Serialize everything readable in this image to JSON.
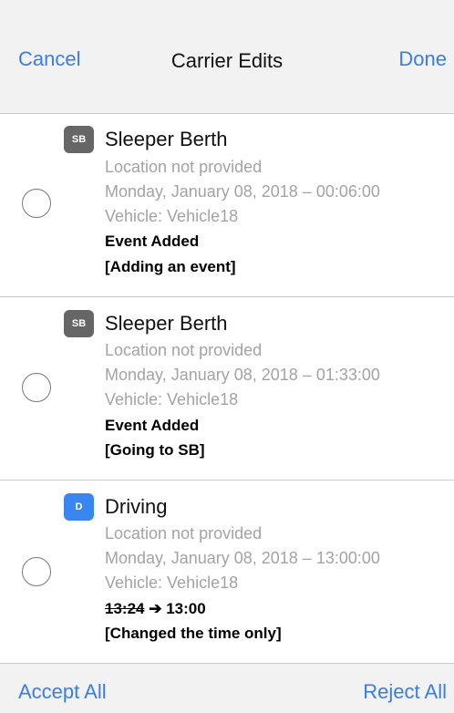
{
  "header": {
    "cancel_label": "Cancel",
    "title": "Carrier Edits",
    "done_label": "Done"
  },
  "events": [
    {
      "badge": "SB",
      "title": "Sleeper Berth",
      "location": "Location not provided",
      "datetime": "Monday, January 08, 2018 – 00:06:00",
      "vehicle": "Vehicle: Vehicle18",
      "change": "Event Added",
      "note": "[Adding an event]"
    },
    {
      "badge": "SB",
      "title": "Sleeper Berth",
      "location": "Location not provided",
      "datetime": "Monday, January 08, 2018 – 01:33:00",
      "vehicle": "Vehicle: Vehicle18",
      "change": "Event Added",
      "note": "[Going to SB]"
    },
    {
      "badge": "D",
      "title": "Driving",
      "location": "Location not provided",
      "datetime": "Monday, January 08, 2018 – 13:00:00",
      "vehicle": "Vehicle: Vehicle18",
      "change_old": "13:24",
      "change_arrow": "➔",
      "change_new": "13:00",
      "note": "[Changed the time only]"
    }
  ],
  "footer": {
    "accept_label": "Accept All",
    "reject_label": "Reject All"
  },
  "colors": {
    "accent": "#3b7de0",
    "badge_sb": "#666666",
    "badge_d": "#3a86f0",
    "muted_text": "#a3a3a3"
  }
}
